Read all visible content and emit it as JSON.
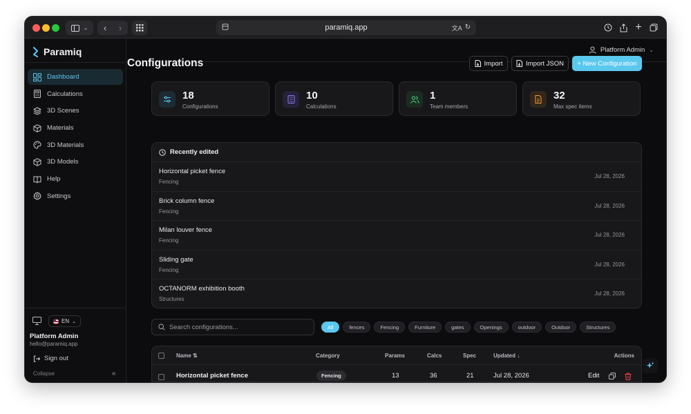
{
  "browser": {
    "url": "paramiq.app",
    "colors": {
      "close": "#ff5f57",
      "minimize": "#febc2e",
      "zoom": "#28c840"
    }
  },
  "app": {
    "name": "Paramiq",
    "accent": "#5bc8ee"
  },
  "sidebar": {
    "items": [
      {
        "label": "Dashboard",
        "icon": "dashboard-icon",
        "active": true
      },
      {
        "label": "Calculations",
        "icon": "calculator-icon"
      },
      {
        "label": "3D Scenes",
        "icon": "layers-icon"
      },
      {
        "label": "Materials",
        "icon": "box-icon"
      },
      {
        "label": "3D Materials",
        "icon": "palette-icon"
      },
      {
        "label": "3D Models",
        "icon": "cube-icon"
      },
      {
        "label": "Help",
        "icon": "book-icon"
      },
      {
        "label": "Settings",
        "icon": "gear-icon"
      }
    ],
    "language": "EN",
    "user_name": "Platform Admin",
    "user_email": "hello@paramiq.app",
    "sign_out": "Sign out",
    "collapse": "Collapse"
  },
  "header": {
    "user": "Platform Admin"
  },
  "page": {
    "title": "Configurations",
    "import": "Import",
    "import_json": "Import JSON",
    "new_config": "+ New Configuration"
  },
  "stats": [
    {
      "value": "18",
      "label": "Configurations",
      "color": "#5bc8ee"
    },
    {
      "value": "10",
      "label": "Calculations",
      "color": "#8b7cf6"
    },
    {
      "value": "1",
      "label": "Team members",
      "color": "#4ade80"
    },
    {
      "value": "32",
      "label": "Max spec items",
      "color": "#f59e3b"
    }
  ],
  "recent": {
    "title": "Recently edited",
    "rows": [
      {
        "name": "Horizontal picket fence",
        "category": "Fencing",
        "date": "Jul 28, 2026"
      },
      {
        "name": "Brick column fence",
        "category": "Fencing",
        "date": "Jul 28, 2026"
      },
      {
        "name": "Milan louver fence",
        "category": "Fencing",
        "date": "Jul 28, 2026"
      },
      {
        "name": "Sliding gate",
        "category": "Fencing",
        "date": "Jul 28, 2026"
      },
      {
        "name": "OCTANORM exhibition booth",
        "category": "Structures",
        "date": "Jul 28, 2026"
      }
    ]
  },
  "search": {
    "placeholder": "Search configurations..."
  },
  "filters": [
    "All",
    "fences",
    "Fencing",
    "Furniture",
    "gates",
    "Openings",
    "outdoor",
    "Outdoor",
    "Structures"
  ],
  "table": {
    "headers": {
      "name": "Name ⇅",
      "category": "Category",
      "params": "Params",
      "calcs": "Calcs",
      "spec": "Spec",
      "updated": "Updated ↓",
      "actions": "Actions"
    },
    "rows": [
      {
        "name": "Horizontal picket fence",
        "category": "Fencing",
        "params": "13",
        "calcs": "36",
        "spec": "21",
        "updated": "Jul 28, 2026",
        "edit": "Edit"
      }
    ]
  }
}
